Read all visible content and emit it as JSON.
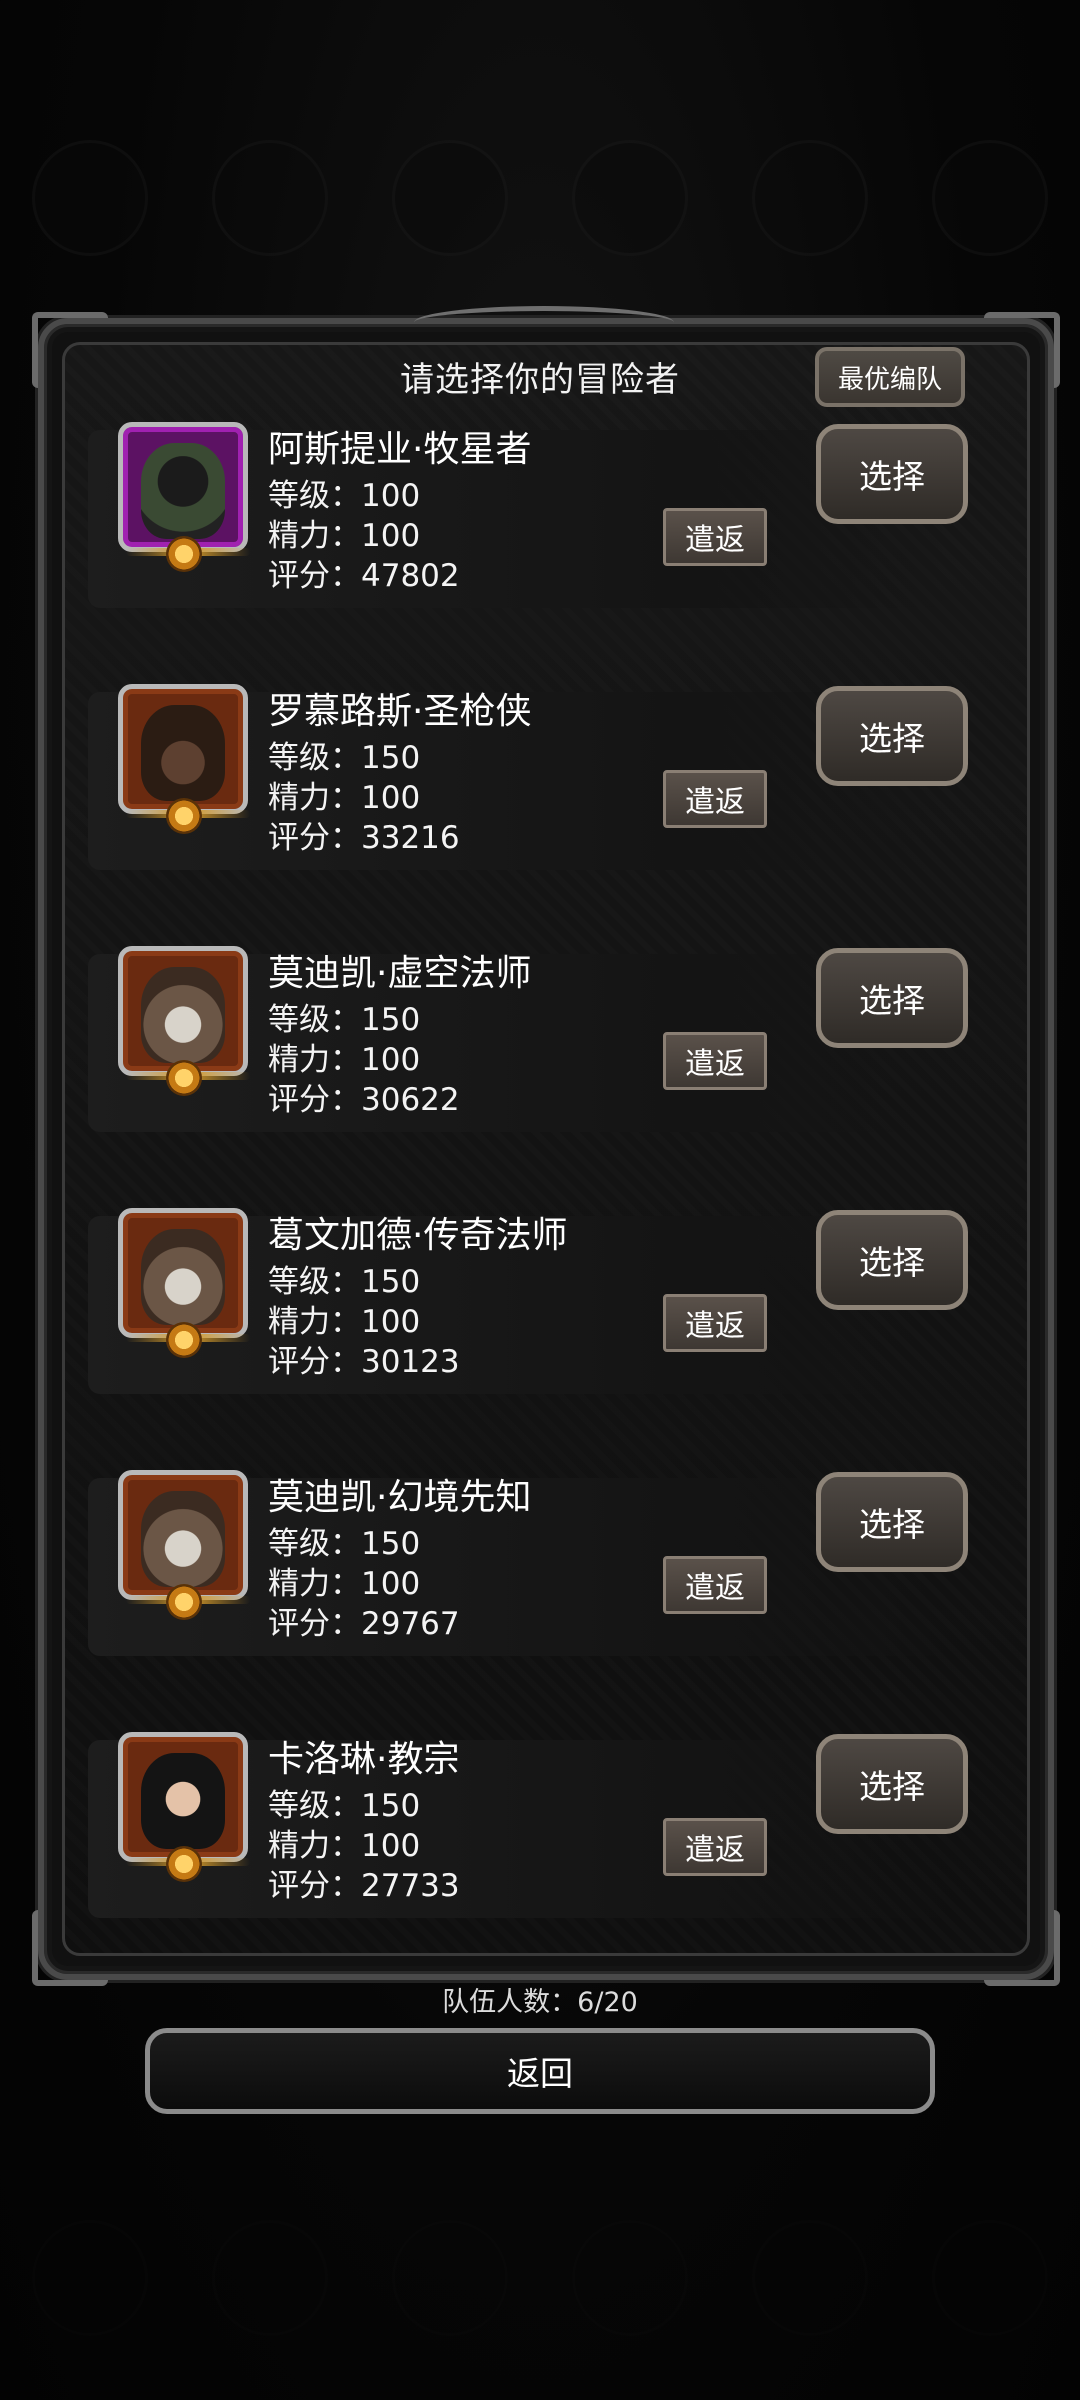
{
  "dialog": {
    "title": "请选择你的冒险者",
    "best_team_label": "最优编队"
  },
  "heroes": [
    {
      "name": "阿斯提业·牧星者",
      "level": "等级：100",
      "energy": "精力：100",
      "score": "评分：47802",
      "dismiss_label": "遣返",
      "select_label": "选择",
      "portrait_icon": "hooded-figure-icon",
      "frame_color": "#a021b0"
    },
    {
      "name": "罗慕路斯·圣枪侠",
      "level": "等级：150",
      "energy": "精力：100",
      "score": "评分：33216",
      "dismiss_label": "遣返",
      "select_label": "选择",
      "portrait_icon": "gunslinger-icon",
      "frame_color": "#8a3a16"
    },
    {
      "name": "莫迪凯·虚空法师",
      "level": "等级：150",
      "energy": "精力：100",
      "score": "评分：30622",
      "dismiss_label": "遣返",
      "select_label": "选择",
      "portrait_icon": "wizard-icon",
      "frame_color": "#8a3a16"
    },
    {
      "name": "葛文加德·传奇法师",
      "level": "等级：150",
      "energy": "精力：100",
      "score": "评分：30123",
      "dismiss_label": "遣返",
      "select_label": "选择",
      "portrait_icon": "wizard-icon",
      "frame_color": "#8a3a16"
    },
    {
      "name": "莫迪凯·幻境先知",
      "level": "等级：150",
      "energy": "精力：100",
      "score": "评分：29767",
      "dismiss_label": "遣返",
      "select_label": "选择",
      "portrait_icon": "wizard-icon",
      "frame_color": "#8a3a16"
    },
    {
      "name": "卡洛琳·教宗",
      "level": "等级：150",
      "energy": "精力：100",
      "score": "评分：27733",
      "dismiss_label": "遣返",
      "select_label": "选择",
      "portrait_icon": "nun-icon",
      "frame_color": "#8a3a16"
    }
  ],
  "team_count": "队伍人数：6/20",
  "back_label": "返回"
}
